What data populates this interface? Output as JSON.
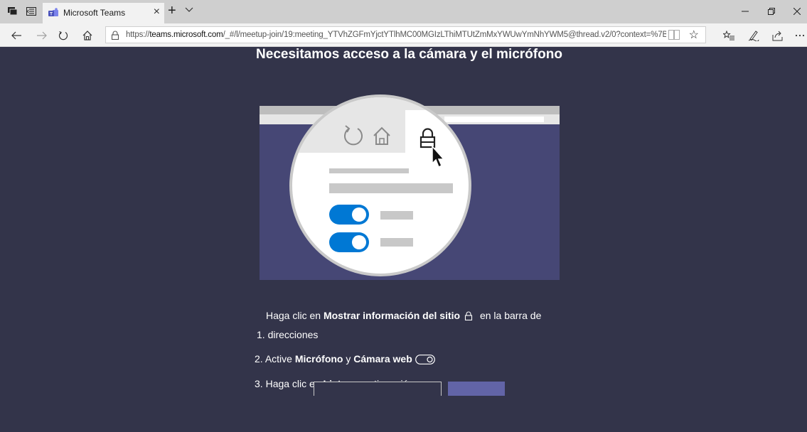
{
  "browser": {
    "tab": {
      "title": "Microsoft Teams"
    },
    "address": {
      "prefix": "https://",
      "host": "teams.microsoft.com",
      "path": "/_#/l/meetup-join/19:meeting_YTVhZGFmYjctYTlhMC00MGIzLThiMTUtZmMxYWUwYmNhYWM5@thread.v2/0?context=%7B%22Ti"
    }
  },
  "page": {
    "title": "Necesitamos acceso a la cámara y el micrófono",
    "steps": [
      {
        "number": "1.",
        "pre": "Haga clic en ",
        "bold": "Mostrar información del sitio",
        "post": " en la barra de",
        "continuation": "direcciones"
      },
      {
        "number": "2.",
        "pre": "Active ",
        "bold": "Micrófono",
        "mid": " y ",
        "bold2": "Cámara web"
      },
      {
        "number": "3.",
        "pre": "Haga clic en ",
        "bold": "Listo",
        "post": " a continuación"
      }
    ]
  },
  "colors": {
    "background": "#33344a",
    "illustration_bg": "#464775",
    "toggle_on": "#0078d4",
    "primary_button": "#6264a7"
  },
  "icons": {
    "tab_favicon": "teams-icon",
    "address_lock": "lock-icon",
    "illustration_lock": "lock-icon",
    "cursor": "cursor-icon"
  }
}
